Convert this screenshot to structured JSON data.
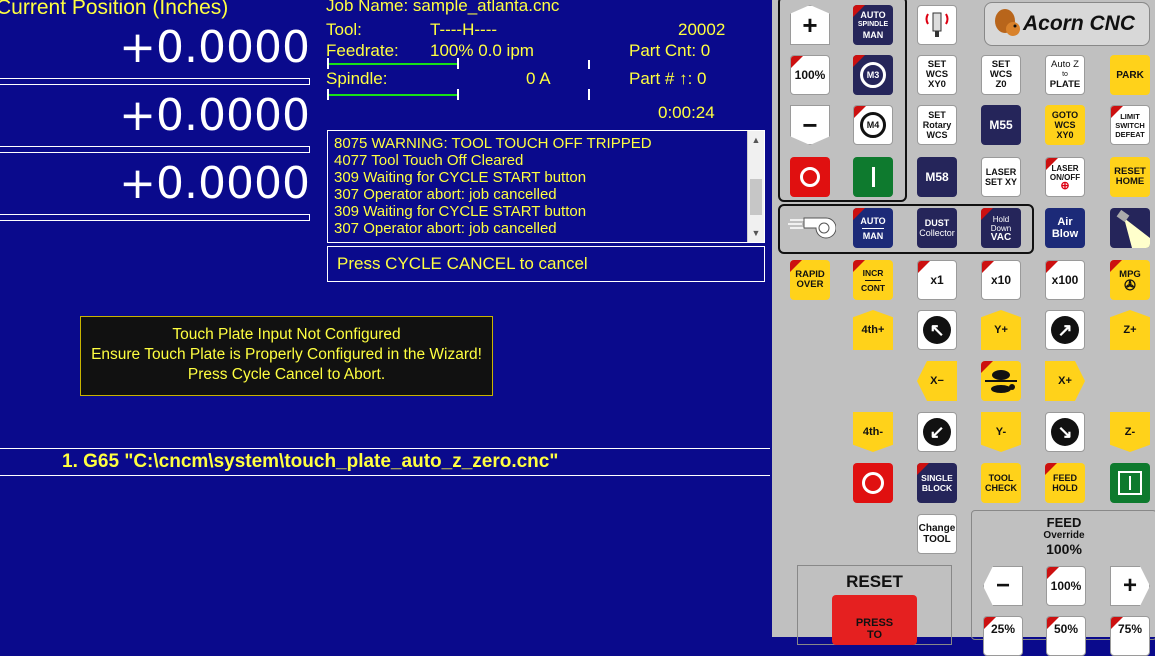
{
  "position": {
    "title": "Current Position (Inches)",
    "axes": [
      "+0.0000",
      "+0.0000",
      "+0.0000"
    ]
  },
  "job": {
    "name_label": "Job Name: sample_atlanta.cnc",
    "tool_label": "Tool:",
    "tool_value": "T----H----",
    "tool_number": "20002",
    "feedrate_label": "Feedrate:",
    "feedrate_value": "100%  0.0 ipm",
    "part_cnt_label": "Part Cnt:  0",
    "spindle_label": "Spindle:",
    "spindle_value": "0  A",
    "part_num_label": "Part # ↑:  0",
    "elapsed": "0:00:24"
  },
  "messages": [
    "8075 WARNING: TOOL TOUCH OFF TRIPPED",
    "4077 Tool Touch Off Cleared",
    "309 Waiting for CYCLE START button",
    "307 Operator abort:  job cancelled",
    "309 Waiting for CYCLE START button",
    "307 Operator abort:  job cancelled"
  ],
  "prompt": "Press CYCLE CANCEL to cancel",
  "notice": {
    "line1": "Touch Plate Input Not Configured",
    "line2": "Ensure Touch Plate is Properly Configured in the Wizard!",
    "line3": "Press Cycle Cancel to Abort."
  },
  "gcode_line": "1. G65 \"C:\\cncm\\system\\touch_plate_auto_z_zero.cnc\"",
  "panel": {
    "logo": "Acorn CNC",
    "spindle_auto_man": [
      "AUTO",
      "SPINDLE",
      "MAN"
    ],
    "spindle_100": "100%",
    "m3": "M3",
    "m4": "M4",
    "set_wcs_xy0": [
      "SET",
      "WCS",
      "XY0"
    ],
    "set_wcs_z0": [
      "SET",
      "WCS",
      "Z0"
    ],
    "auto_z_plate": [
      "Auto Z",
      "to",
      "PLATE"
    ],
    "park": "PARK",
    "set_rotary": [
      "SET",
      "Rotary",
      "WCS"
    ],
    "m55": "M55",
    "goto_wcs": [
      "GOTO",
      "WCS",
      "XY0"
    ],
    "limit_defeat": [
      "LIMIT",
      "SWITCH",
      "DEFEAT"
    ],
    "m58": "M58",
    "laser_set": [
      "LASER",
      "SET XY"
    ],
    "laser_onoff": [
      "LASER",
      "ON/OFF"
    ],
    "reset_home": [
      "RESET",
      "HOME"
    ],
    "coolant_auto_man": [
      "AUTO",
      "MAN"
    ],
    "dust_collector": [
      "DUST",
      "Collector"
    ],
    "hold_down_vac": [
      "Hold",
      "Down",
      "VAC"
    ],
    "air_blow": [
      "Air",
      "Blow"
    ],
    "rapid_over": [
      "RAPID",
      "OVER"
    ],
    "incr_cont": [
      "INCR",
      "CONT"
    ],
    "x1": "x1",
    "x10": "x10",
    "x100": "x100",
    "mpg": "MPG",
    "jog_4th_plus": "4th+",
    "jog_y_plus": "Y+",
    "jog_z_plus": "Z+",
    "jog_x_minus": "X−",
    "jog_x_plus": "X+",
    "jog_4th_minus": "4th-",
    "jog_y_minus": "Y-",
    "jog_z_minus": "Z-",
    "single_block": [
      "SINGLE",
      "BLOCK"
    ],
    "tool_check": [
      "TOOL",
      "CHECK"
    ],
    "feed_hold": [
      "FEED",
      "HOLD"
    ],
    "change_tool": [
      "Change",
      "TOOL"
    ],
    "feed_override": [
      "FEED",
      "Override",
      "100%"
    ],
    "feed_100": "100%",
    "feed_bottom": [
      "25%",
      "50%",
      "75%"
    ],
    "reset_label": "RESET",
    "press_to": [
      "PRESS",
      "TO"
    ]
  }
}
